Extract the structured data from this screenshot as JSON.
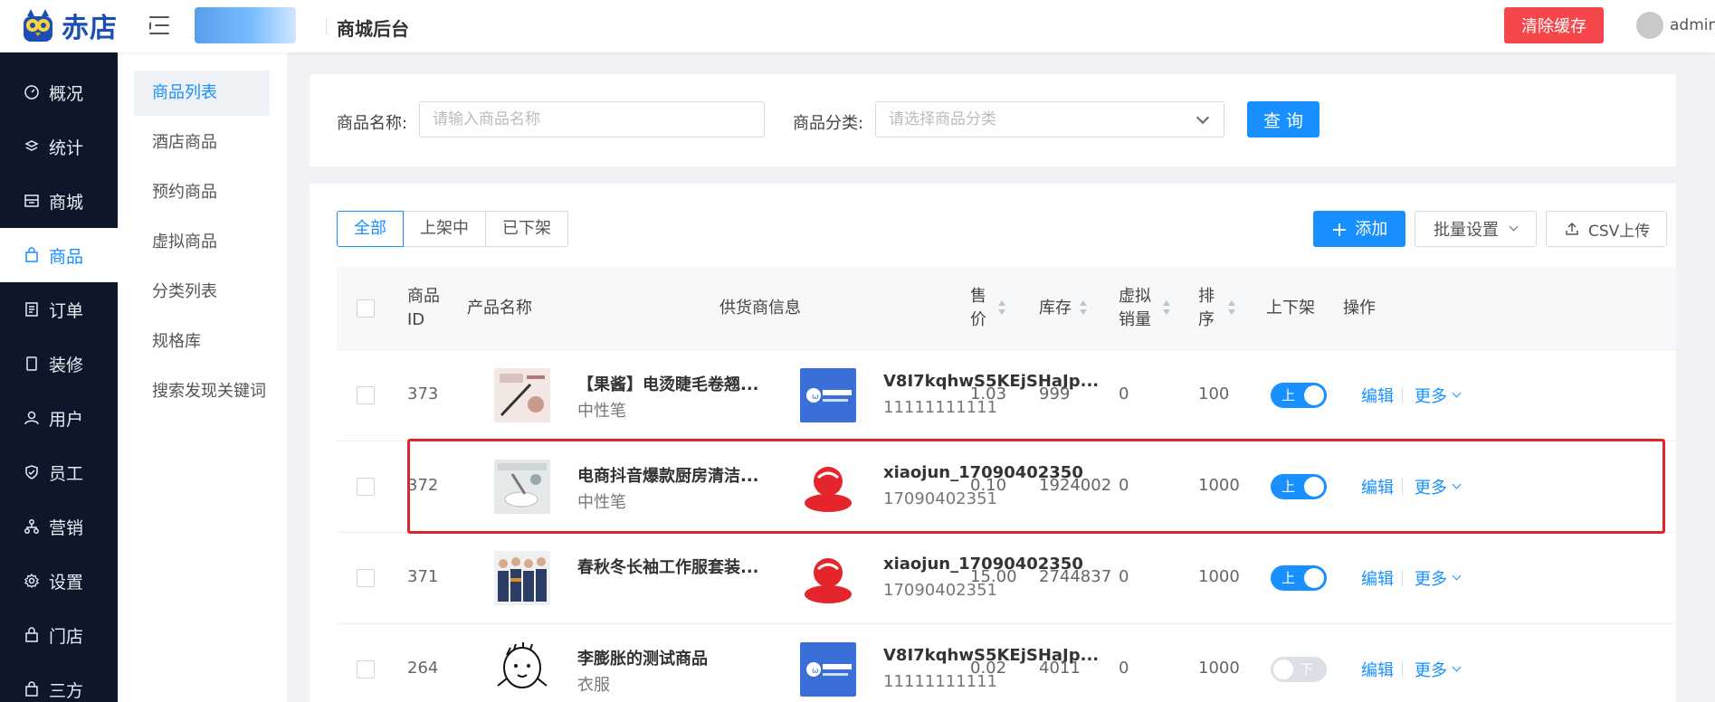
{
  "header": {
    "logo_text": "赤店",
    "title": "商城后台",
    "clear_cache": "清除缓存",
    "user": "admin",
    "logo_color": "#1c4fb5",
    "danger_color": "#f5474b"
  },
  "sidebar": {
    "items": [
      {
        "label": "概况",
        "icon": "dashboard-icon"
      },
      {
        "label": "统计",
        "icon": "stats-icon"
      },
      {
        "label": "商城",
        "icon": "store-icon"
      },
      {
        "label": "商品",
        "icon": "bag-icon",
        "active": true
      },
      {
        "label": "订单",
        "icon": "order-icon"
      },
      {
        "label": "装修",
        "icon": "decor-icon"
      },
      {
        "label": "用户",
        "icon": "user-icon"
      },
      {
        "label": "员工",
        "icon": "shield-icon"
      },
      {
        "label": "营销",
        "icon": "marketing-icon"
      },
      {
        "label": "设置",
        "icon": "gear-icon"
      },
      {
        "label": "门店",
        "icon": "shop-icon"
      },
      {
        "label": "三方",
        "icon": "bag-icon"
      }
    ]
  },
  "submenu": {
    "items": [
      "商品列表",
      "酒店商品",
      "预约商品",
      "虚拟商品",
      "分类列表",
      "规格库",
      "搜索发现关键词"
    ]
  },
  "search": {
    "name_label": "商品名称:",
    "name_placeholder": "请输入商品名称",
    "category_label": "商品分类:",
    "category_placeholder": "请选择商品分类",
    "query": "查 询"
  },
  "toolbar": {
    "tabs": [
      "全部",
      "上架中",
      "已下架"
    ],
    "add": "添加",
    "batch": "批量设置",
    "csv": "CSV上传"
  },
  "table": {
    "headers": {
      "id": [
        "商品",
        "ID"
      ],
      "name": "产品名称",
      "supplier": "供货商信息",
      "price": [
        "售",
        "价"
      ],
      "stock": "库存",
      "virtual_sales": [
        "虚拟",
        "销量"
      ],
      "sort": [
        "排",
        "序"
      ],
      "status": "上下架",
      "ops": "操作"
    },
    "edit": "编辑",
    "more": "更多",
    "rows": [
      {
        "id": "373",
        "name": "【果酱】电烫睫毛卷翘...",
        "category": "中性笔",
        "supplier": "V8I7kqhwS5KEjSHaJp...",
        "phone": "11111111111",
        "sup_logo": "blue",
        "price": "1.03",
        "stock": "999",
        "virtual": "0",
        "sort": "100",
        "on": true,
        "switch_label": "上"
      },
      {
        "id": "372",
        "name": "电商抖音爆款厨房清洁...",
        "category": "中性笔",
        "supplier": "xiaojun_17090402350",
        "phone": "17090402351",
        "sup_logo": "red",
        "price": "0.10",
        "stock": "1924002",
        "virtual": "0",
        "sort": "1000",
        "on": true,
        "switch_label": "上"
      },
      {
        "id": "371",
        "name": "春秋冬长袖工作服套装...",
        "category": "",
        "supplier": "xiaojun_17090402350",
        "phone": "17090402351",
        "sup_logo": "red",
        "price": "15.00",
        "stock": "2744837",
        "virtual": "0",
        "sort": "1000",
        "on": true,
        "switch_label": "上"
      },
      {
        "id": "264",
        "name": "李膨胀的测试商品",
        "category": "衣服",
        "supplier": "V8I7kqhwS5KEjSHaJp...",
        "phone": "11111111111",
        "sup_logo": "blue",
        "price": "0.02",
        "stock": "4011",
        "virtual": "0",
        "sort": "1000",
        "on": false,
        "switch_label": "下"
      }
    ]
  },
  "colors": {
    "primary": "#1890ff",
    "sidebar_bg": "#0c1829",
    "highlight": "#e0242b"
  }
}
